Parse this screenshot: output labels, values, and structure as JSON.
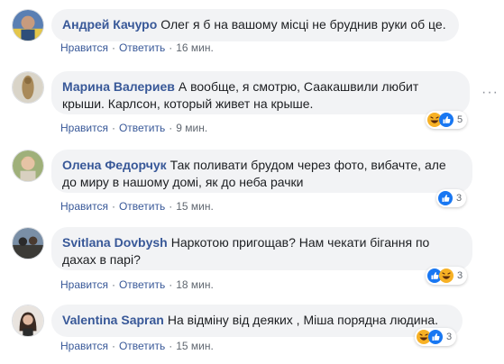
{
  "comments": [
    {
      "author": "Андрей Качуро",
      "text": "Олег я б на вашому місці не бруднив руки об це.",
      "like": "Нравится",
      "reply": "Ответить",
      "time": "16 мин.",
      "reaction_count": null,
      "reactions": []
    },
    {
      "author": "Марина Валериев",
      "text": "А вообще, я смотрю, Саакашвили любит крыши. Карлсон, который живет на крыше.",
      "like": "Нравится",
      "reply": "Ответить",
      "time": "9 мин.",
      "reaction_count": "5",
      "reactions": [
        "haha",
        "like"
      ]
    },
    {
      "author": "Олена Федорчук",
      "text": "Так поливати брудом через фото, вибачте, але до миру в нашому домі, як до неба рачки",
      "like": "Нравится",
      "reply": "Ответить",
      "time": "15 мин.",
      "reaction_count": "3",
      "reactions": [
        "like"
      ]
    },
    {
      "author": "Svitlana Dovbysh",
      "text": "Наркотою пригощав? Нам чекати бігання по дахах в парі?",
      "like": "Нравится",
      "reply": "Ответить",
      "time": "18 мин.",
      "reaction_count": "3",
      "reactions": [
        "like",
        "haha"
      ]
    },
    {
      "author": "Valentina Sapran",
      "text": "На відміну від деяких , Міша порядна людина.",
      "like": "Нравится",
      "reply": "Ответить",
      "time": "15 мин.",
      "reaction_count": "3",
      "reactions": [
        "haha",
        "like"
      ]
    }
  ],
  "colors": {
    "author": "#385898",
    "bubble": "#f2f3f5",
    "meta": "#606770",
    "like_blue": "#1877f2",
    "haha_yellow": "#f7b125"
  }
}
